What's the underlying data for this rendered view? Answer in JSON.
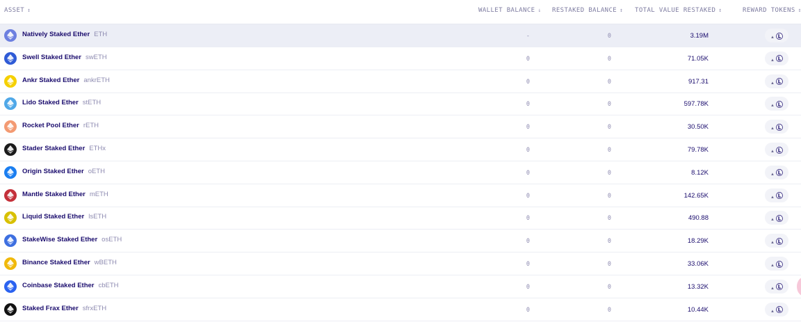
{
  "header": {
    "asset": "ASSET",
    "wallet_balance": "WALLET BALANCE",
    "restaked_balance": "RESTAKED BALANCE",
    "total_value_restaked": "TOTAL VALUE RESTAKED",
    "reward_tokens": "REWARD TOKENS",
    "sort_icon": "↕",
    "sort_desc_icon": "↓"
  },
  "rows": [
    {
      "name": "Natively Staked Ether",
      "symbol": "ETH",
      "wallet": "-",
      "restaked": "0",
      "tvr": "3.19M",
      "icon": "ethereum-icon",
      "color": "#6c7fe0"
    },
    {
      "name": "Swell Staked Ether",
      "symbol": "swETH",
      "wallet": "0",
      "restaked": "0",
      "tvr": "71.05K",
      "icon": "swell-icon",
      "color": "#2f5bd6"
    },
    {
      "name": "Ankr Staked Ether",
      "symbol": "ankrETH",
      "wallet": "0",
      "restaked": "0",
      "tvr": "917.31",
      "icon": "ankr-icon",
      "color": "#f5d000"
    },
    {
      "name": "Lido Staked Ether",
      "symbol": "stETH",
      "wallet": "0",
      "restaked": "0",
      "tvr": "597.78K",
      "icon": "lido-drop-icon",
      "color": "#4fa8e8"
    },
    {
      "name": "Rocket Pool Ether",
      "symbol": "rETH",
      "wallet": "0",
      "restaked": "0",
      "tvr": "30.50K",
      "icon": "rocket-pool-icon",
      "color": "#f39a72"
    },
    {
      "name": "Stader Staked Ether",
      "symbol": "ETHx",
      "wallet": "0",
      "restaked": "0",
      "tvr": "79.78K",
      "icon": "stader-icon",
      "color": "#1b1b1b"
    },
    {
      "name": "Origin Staked Ether",
      "symbol": "oETH",
      "wallet": "0",
      "restaked": "0",
      "tvr": "8.12K",
      "icon": "origin-icon",
      "color": "#1a7ef0"
    },
    {
      "name": "Mantle Staked Ether",
      "symbol": "mETH",
      "wallet": "0",
      "restaked": "0",
      "tvr": "142.65K",
      "icon": "mantle-icon",
      "color": "#c4303a"
    },
    {
      "name": "Liquid Staked Ether",
      "symbol": "lsETH",
      "wallet": "0",
      "restaked": "0",
      "tvr": "490.88",
      "icon": "liquid-collective-icon",
      "color": "#d8c000"
    },
    {
      "name": "StakeWise Staked Ether",
      "symbol": "osETH",
      "wallet": "0",
      "restaked": "0",
      "tvr": "18.29K",
      "icon": "stakewise-icon",
      "color": "#3d6fe0"
    },
    {
      "name": "Binance Staked Ether",
      "symbol": "wBETH",
      "wallet": "0",
      "restaked": "0",
      "tvr": "33.06K",
      "icon": "binance-icon",
      "color": "#f0b90b"
    },
    {
      "name": "Coinbase Staked Ether",
      "symbol": "cbETH",
      "wallet": "0",
      "restaked": "0",
      "tvr": "13.32K",
      "icon": "coinbase-icon",
      "color": "#2a62f0"
    },
    {
      "name": "Staked Frax Ether",
      "symbol": "sfrxETH",
      "wallet": "0",
      "restaked": "0",
      "tvr": "10.44K",
      "icon": "frax-icon",
      "color": "#111111"
    }
  ],
  "reward_token": {
    "small_glyph": "▲",
    "label": "Ⓛ",
    "icon": "eigenlayer-icon"
  }
}
